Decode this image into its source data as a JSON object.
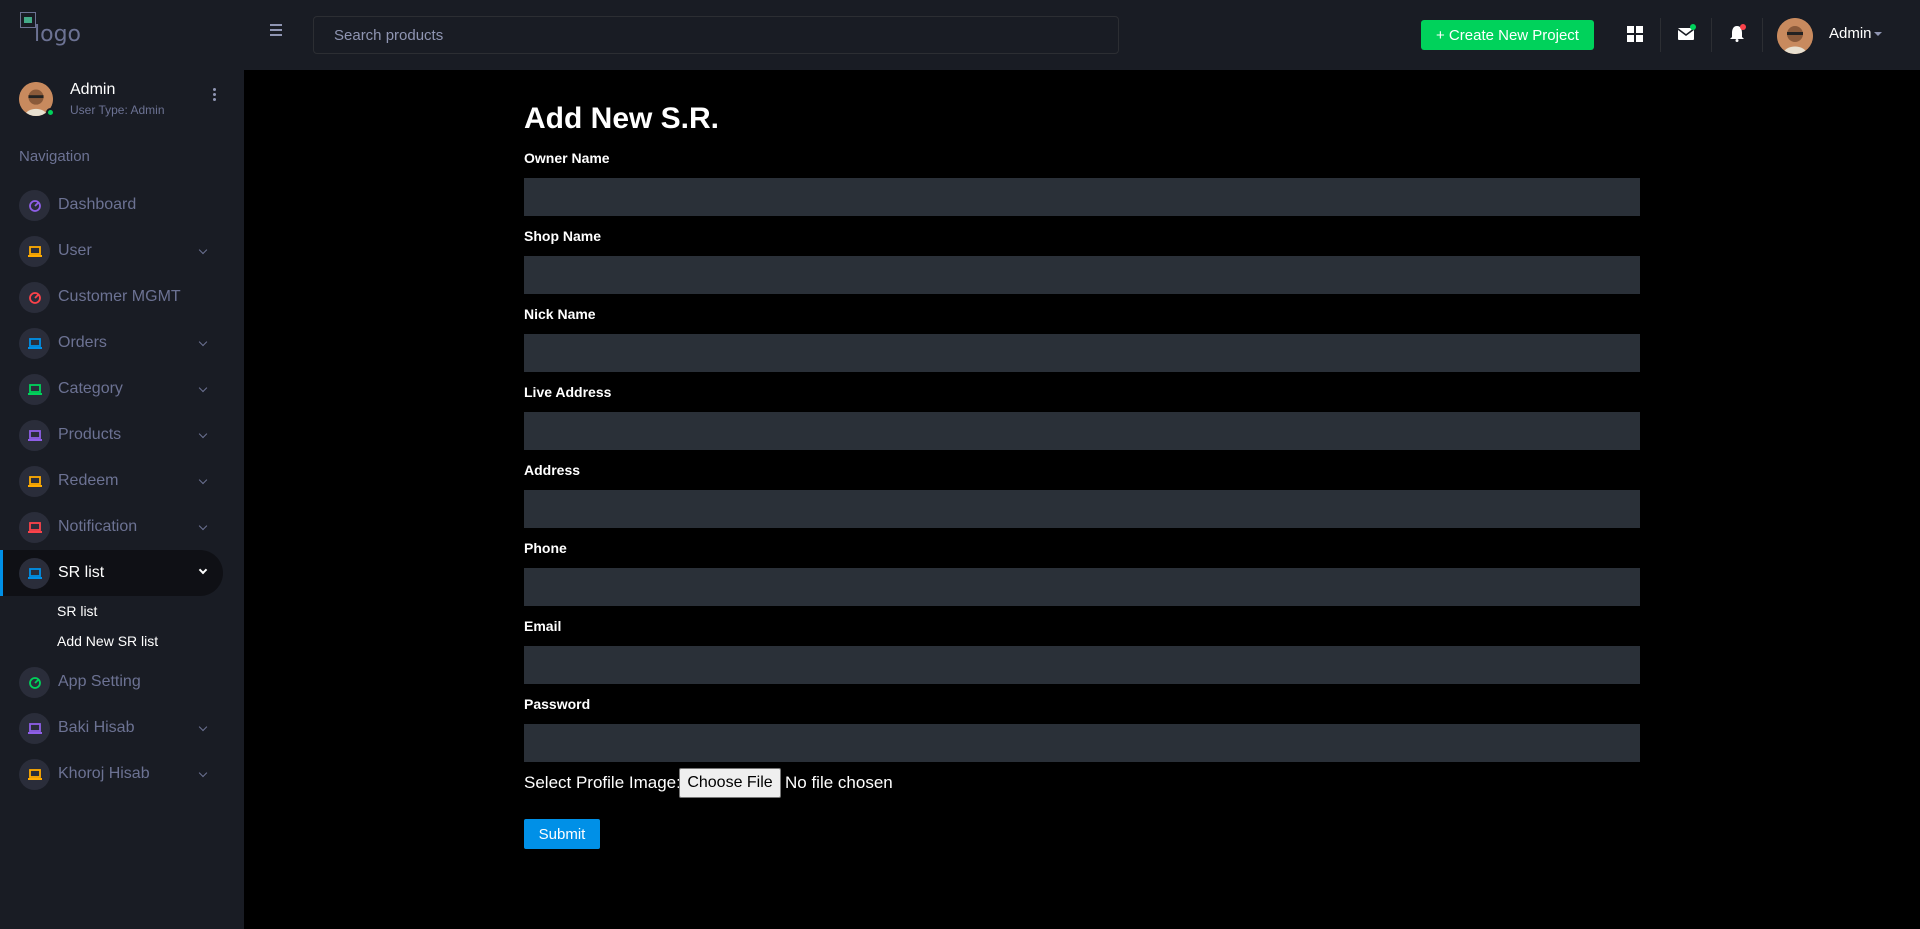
{
  "header": {
    "logo_alt": "logo",
    "search_placeholder": "Search products",
    "create_label": "+ Create New Project",
    "user_name": "Admin"
  },
  "profile": {
    "name": "Admin",
    "type": "User Type: Admin"
  },
  "sidebar": {
    "heading": "Navigation",
    "items": [
      {
        "label": "Dashboard",
        "icon": "speedometer-icon",
        "color": "#8f5fe8"
      },
      {
        "label": "User",
        "icon": "laptop-icon",
        "color": "#ffab00"
      },
      {
        "label": "Customer MGMT",
        "icon": "speedometer-icon",
        "color": "#fc424a"
      },
      {
        "label": "Orders",
        "icon": "laptop-icon",
        "color": "#0090e7"
      },
      {
        "label": "Category",
        "icon": "laptop-icon",
        "color": "#00d25b"
      },
      {
        "label": "Products",
        "icon": "laptop-icon",
        "color": "#8f5fe8"
      },
      {
        "label": "Redeem",
        "icon": "laptop-icon",
        "color": "#ffab00"
      },
      {
        "label": "Notification",
        "icon": "laptop-icon",
        "color": "#fc424a"
      },
      {
        "label": "SR list",
        "icon": "laptop-icon",
        "color": "#0090e7"
      },
      {
        "label": "App Setting",
        "icon": "speedometer-icon",
        "color": "#00d25b"
      },
      {
        "label": "Baki Hisab",
        "icon": "laptop-icon",
        "color": "#8f5fe8"
      },
      {
        "label": "Khoroj Hisab",
        "icon": "laptop-icon",
        "color": "#ffab00"
      }
    ],
    "sub_items": [
      "SR list",
      "Add New SR list"
    ]
  },
  "form": {
    "title": "Add New S.R.",
    "fields": [
      {
        "label": "Owner Name",
        "value": ""
      },
      {
        "label": "Shop Name",
        "value": ""
      },
      {
        "label": "Nick Name",
        "value": ""
      },
      {
        "label": "Live Address",
        "value": ""
      },
      {
        "label": "Address",
        "value": ""
      },
      {
        "label": "Phone",
        "value": ""
      },
      {
        "label": "Email",
        "value": ""
      },
      {
        "label": "Password",
        "value": ""
      }
    ],
    "file_label": "Select Profile Image:",
    "file_button": "Choose File",
    "file_status": "No file chosen",
    "submit_label": "Submit"
  },
  "colors": {
    "accent": "#0090e7",
    "success": "#00d25b",
    "danger": "#fc424a"
  }
}
